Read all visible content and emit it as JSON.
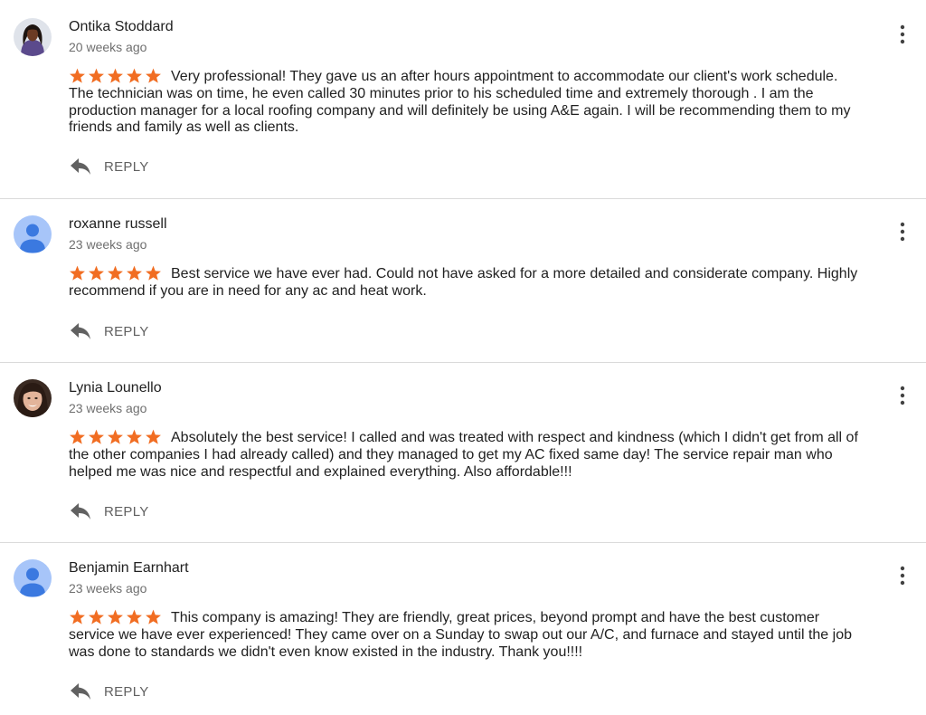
{
  "colors": {
    "star": "#f16d22",
    "divider": "#dadada",
    "secondary": "#6f6f6f",
    "reply": "#616161"
  },
  "icons": {
    "rating": "star-icon",
    "reply": "reply-arrow-icon",
    "menu": "more-vert-icon",
    "default_avatar": "person-icon"
  },
  "reviews": [
    {
      "name": "Ontika Stoddard",
      "time": "20 weeks ago",
      "rating": 5,
      "text": "Very professional! They gave us an after hours appointment to accommodate our client's work schedule. The technician was on time, he even called 30 minutes prior to his scheduled time and extremely thorough . I am the production manager for a local roofing company and will definitely be using A&E again. I will be recommending them to my friends and family as well as clients.",
      "reply_label": "REPLY"
    },
    {
      "name": "roxanne russell",
      "time": "23 weeks ago",
      "rating": 5,
      "text": "Best service we have ever had. Could not have asked for a more detailed and considerate company. Highly recommend if you are in need for any ac and heat work.",
      "reply_label": "REPLY"
    },
    {
      "name": "Lynia Lounello",
      "time": "23 weeks ago",
      "rating": 5,
      "text": "Absolutely the best service! I called and was treated with respect and kindness (which I didn't get from all of the other companies I had already called) and they managed to get my AC fixed same day! The service repair man who helped me was nice and respectful and explained everything. Also affordable!!!",
      "reply_label": "REPLY"
    },
    {
      "name": "Benjamin Earnhart",
      "time": "23 weeks ago",
      "rating": 5,
      "text": "This company is amazing! They are friendly, great prices, beyond prompt and have the best customer service we have ever experienced! They came over on a Sunday to swap out our A/C, and furnace and stayed until the job was done to standards we didn't even know existed in the industry. Thank you!!!!",
      "reply_label": "REPLY"
    }
  ]
}
